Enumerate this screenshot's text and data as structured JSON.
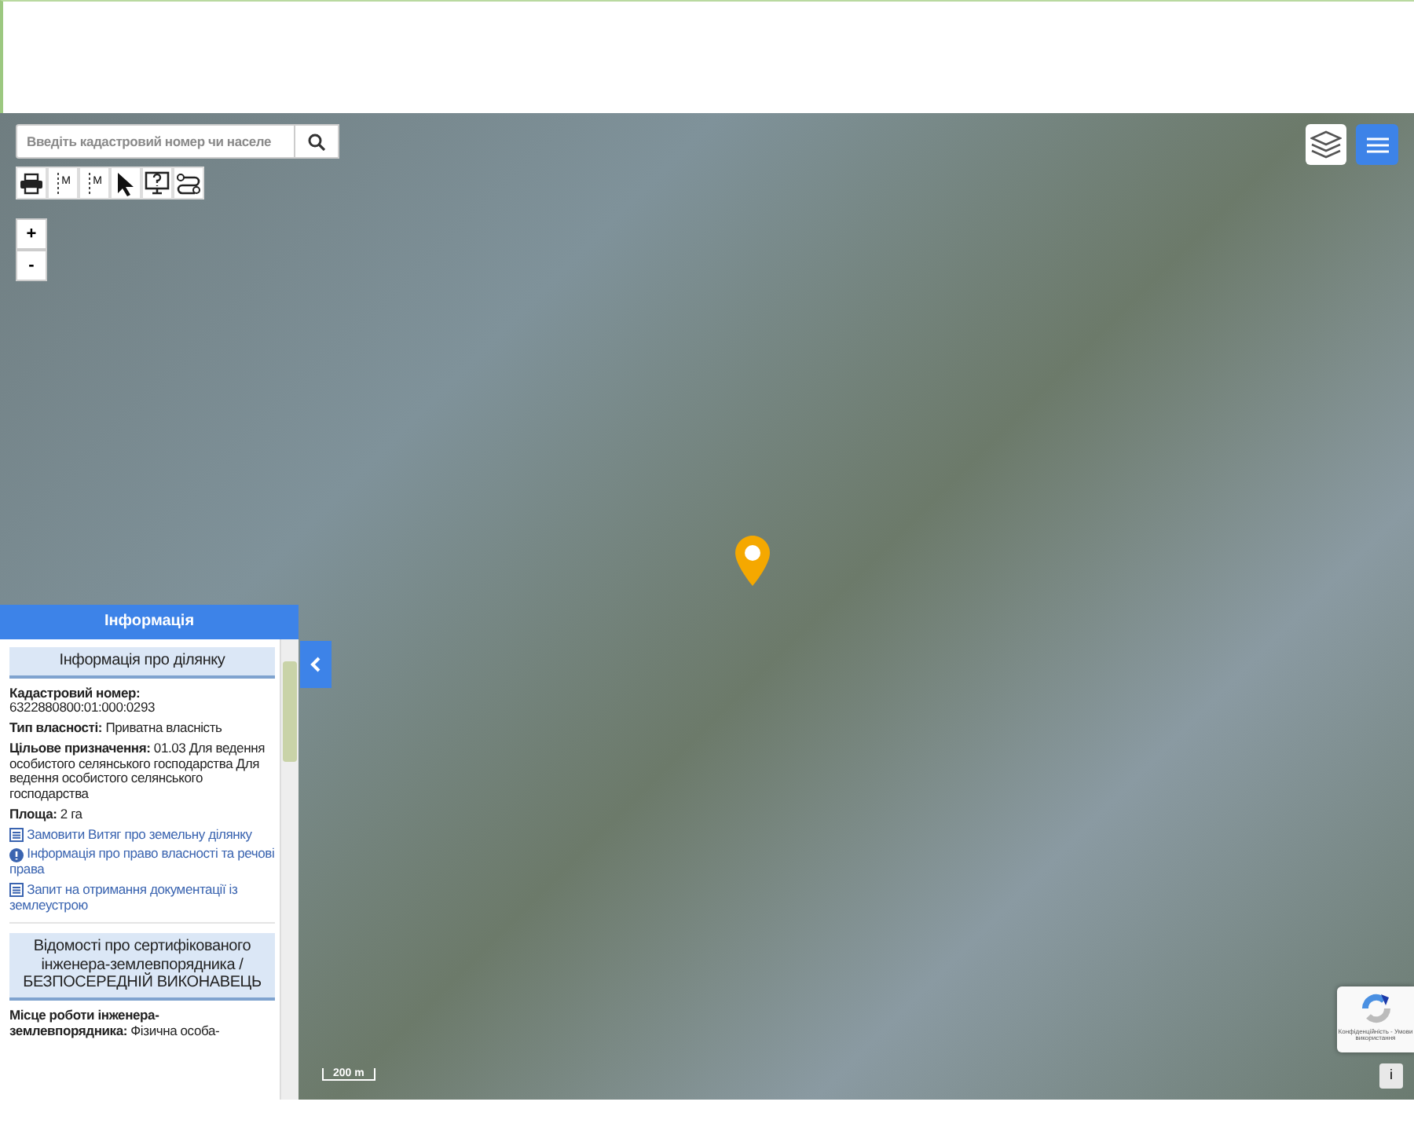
{
  "search": {
    "placeholder": "Введіть кадастровий номер чи населе"
  },
  "tools": [
    {
      "kind": "print"
    },
    {
      "kind": "measure-line",
      "label": "M"
    },
    {
      "kind": "measure-area",
      "label": "M"
    },
    {
      "kind": "pointer"
    },
    {
      "kind": "help"
    },
    {
      "kind": "route"
    }
  ],
  "zoom_buttons": [
    "+",
    "-"
  ],
  "info_panel": {
    "title": "Інформація",
    "sections": [
      {
        "heading": "Інформація про ділянку",
        "items": [
          {
            "kind": "stacked-field",
            "label": "Кадастровий номер:",
            "value": "6322880800:01:000:0293"
          },
          {
            "kind": "field",
            "label": "Тип власності:",
            "value": "Приватна власність"
          },
          {
            "kind": "field",
            "label": "Цільове призначення:",
            "value": "01.03 Для ведення особистого селянського господарства Для ведення особистого селянського господарства"
          },
          {
            "kind": "field",
            "label": "Площа:",
            "value": "2 га"
          },
          {
            "kind": "document-link",
            "text": "Замовити Витяг про земельну ділянку"
          },
          {
            "kind": "info-link",
            "text": "Інформація про право власності та речові права"
          },
          {
            "kind": "document-link",
            "text": "Запит на отримання документації із землеустрою"
          }
        ]
      },
      {
        "heading": "Відомості про сертифікованого інженера-землевпорядника / БЕЗПОСЕРЕДНІЙ ВИКОНАВЕЦЬ",
        "items": [
          {
            "kind": "field",
            "label": "Місце роботи інженера-землевпорядника:",
            "value": "Фізична особа-"
          }
        ]
      }
    ]
  },
  "scale": "200 m",
  "recaptcha": {
    "text": "Конфіденційність - Умови використання"
  },
  "info_button": "i"
}
